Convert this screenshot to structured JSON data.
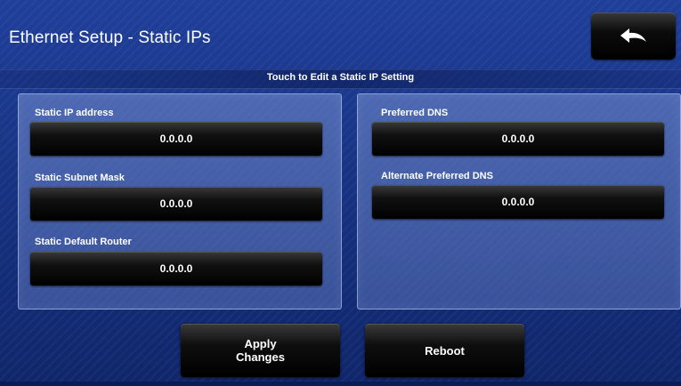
{
  "header": {
    "title": "Ethernet Setup - Static IPs",
    "back_icon": "back-arrow-icon",
    "instruction": "Touch to Edit a Static IP Setting"
  },
  "left_panel": {
    "fields": [
      {
        "label": "Static IP address",
        "value": "0.0.0.0"
      },
      {
        "label": "Static Subnet Mask",
        "value": "0.0.0.0"
      },
      {
        "label": "Static Default Router",
        "value": "0.0.0.0"
      }
    ]
  },
  "right_panel": {
    "fields": [
      {
        "label": "Preferred DNS",
        "value": "0.0.0.0"
      },
      {
        "label": "Alternate Preferred DNS",
        "value": "0.0.0.0"
      }
    ]
  },
  "actions": {
    "apply_line1": "Apply",
    "apply_line2": "Changes",
    "reboot": "Reboot"
  },
  "colors": {
    "background": "#173382",
    "panel": "#6f87c8",
    "button": "#000000",
    "text": "#ffffff"
  }
}
